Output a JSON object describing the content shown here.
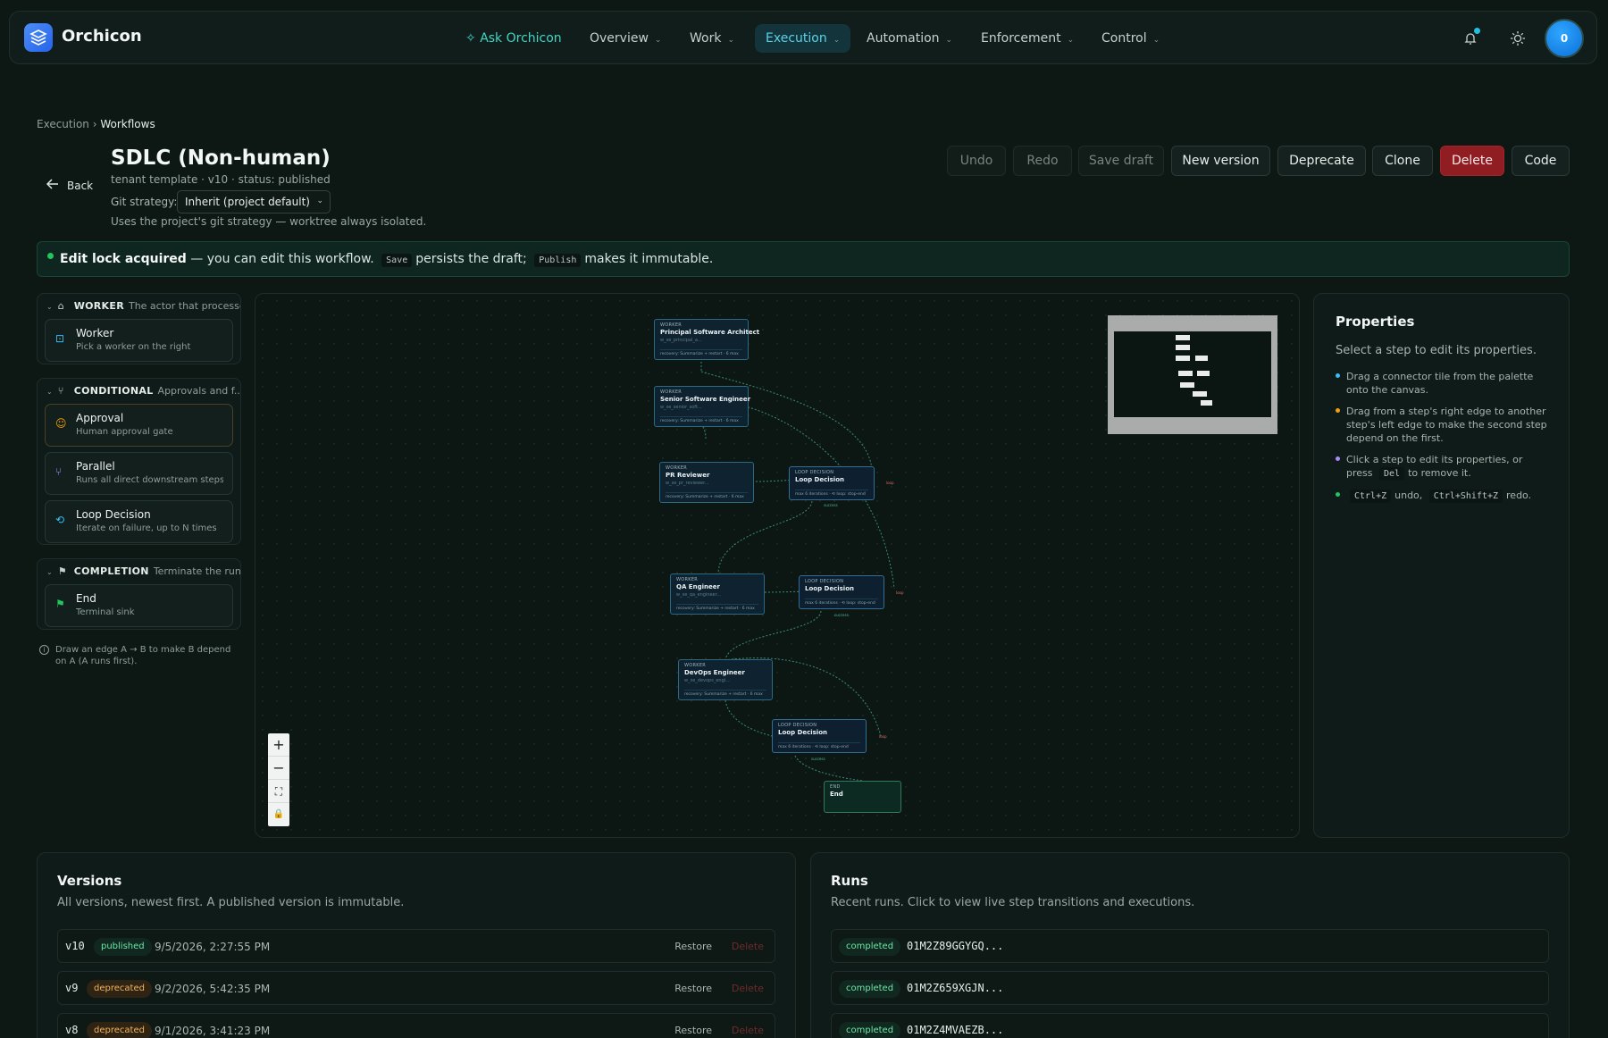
{
  "nav": {
    "brand": "Orchicon",
    "ask": "Ask Orchicon",
    "items": [
      "Overview",
      "Work",
      "Execution",
      "Automation",
      "Enforcement",
      "Control"
    ],
    "avatar": "0",
    "colors": {
      "accent": "#5ad1e8",
      "ask": "#3fd6c6",
      "danger": "#8f1d22",
      "success": "#22c55e"
    }
  },
  "breadcrumb": {
    "parent": "Execution",
    "sep": "›",
    "current": "Workflows"
  },
  "header": {
    "back": "Back",
    "title": "SDLC (Non-human)",
    "subtitle": "tenant template · v10 · status: published",
    "git_label": "Git strategy:",
    "git_value": "Inherit (project default)",
    "git_note": "Uses the project's git strategy — worktree always isolated."
  },
  "toolbar": {
    "undo": "Undo",
    "redo": "Redo",
    "save_draft": "Save draft",
    "new_version": "New version",
    "deprecate": "Deprecate",
    "clone": "Clone",
    "delete": "Delete",
    "code": "Code"
  },
  "banner": {
    "bold": "Edit lock acquired",
    "text1": "— you can edit this workflow.",
    "save": "Save",
    "text2": "persists the draft;",
    "publish": "Publish",
    "text3": "makes it immutable."
  },
  "palette": {
    "worker": {
      "name": "WORKER",
      "desc": "The actor that processe...",
      "tiles": [
        {
          "name": "Worker",
          "desc": "Pick a worker on the right"
        }
      ]
    },
    "conditional": {
      "name": "CONDITIONAL",
      "desc": "Approvals and f...",
      "tiles": [
        {
          "name": "Approval",
          "desc": "Human approval gate"
        },
        {
          "name": "Parallel",
          "desc": "Runs all direct downstream steps co..."
        },
        {
          "name": "Loop Decision",
          "desc": "Iterate on failure, up to N times"
        }
      ]
    },
    "completion": {
      "name": "COMPLETION",
      "desc": "Terminate the run",
      "tiles": [
        {
          "name": "End",
          "desc": "Terminal sink"
        }
      ]
    },
    "hint_a": "Draw an edge A",
    "hint_arrow": "→",
    "hint_b": "B to make B depend on A (A runs first)."
  },
  "canvas": {
    "nodes": [
      {
        "kind": "WORKER",
        "title": "Principal Software Architect",
        "sub": "w_se_principal_a...",
        "foot": "recovery: Summarize + restart · 6 max"
      },
      {
        "kind": "WORKER",
        "title": "Senior Software Engineer",
        "sub": "w_se_senior_soft...",
        "foot": "recovery: Summarize + restart · 6 max"
      },
      {
        "kind": "WORKER",
        "title": "PR Reviewer",
        "sub": "w_se_pr_reviewer...",
        "foot": "recovery: Summarize + restart · 6 max"
      },
      {
        "kind": "LOOP DECISION",
        "title": "Loop Decision",
        "sub": "",
        "foot": "max 6 iterations · ⟲ loop: stop-end"
      },
      {
        "kind": "WORKER",
        "title": "QA Engineer",
        "sub": "w_se_qa_engineer...",
        "foot": "recovery: Summarize + restart · 6 max"
      },
      {
        "kind": "LOOP DECISION",
        "title": "Loop Decision",
        "sub": "",
        "foot": "max 6 iterations · ⟲ loop: stop-end"
      },
      {
        "kind": "WORKER",
        "title": "DevOps Engineer",
        "sub": "w_se_devops_engi...",
        "foot": "recovery: Summarize + restart · 6 max"
      },
      {
        "kind": "LOOP DECISION",
        "title": "Loop Decision",
        "sub": "",
        "foot": "max 6 iterations · ⟲ loop: stop-end"
      },
      {
        "kind": "END",
        "title": "End",
        "sub": "",
        "foot": ""
      }
    ],
    "edge_labels": {
      "loop": "loop",
      "success": "success"
    },
    "zoom": [
      "+",
      "−",
      "⛶",
      "🔒"
    ]
  },
  "properties": {
    "title": "Properties",
    "hint": "Select a step to edit its properties.",
    "tips": [
      {
        "text": "Drag a connector tile from the palette onto the canvas.",
        "color": "#38bdf8"
      },
      {
        "text": "Drag from a step's right edge to another step's left edge to make the second step depend on the first.",
        "color": "#f59e0b"
      },
      {
        "text_a": "Click a step to edit its properties, or press",
        "key": "Del",
        "text_b": "to remove it.",
        "color": "#a78bfa"
      },
      {
        "key1": "Ctrl+Z",
        "mid": "undo,",
        "key2": "Ctrl+Shift+Z",
        "end": "redo.",
        "color": "#22c55e"
      }
    ]
  },
  "versions": {
    "title": "Versions",
    "desc": "All versions, newest first. A published version is immutable.",
    "restore": "Restore",
    "delete": "Delete",
    "rows": [
      {
        "v": "v10",
        "status": "published",
        "date": "9/5/2026, 2:27:55 PM"
      },
      {
        "v": "v9",
        "status": "deprecated",
        "date": "9/2/2026, 5:42:35 PM"
      },
      {
        "v": "v8",
        "status": "deprecated",
        "date": "9/1/2026, 3:41:23 PM"
      }
    ]
  },
  "runs": {
    "title": "Runs",
    "desc": "Recent runs. Click to view live step transitions and executions.",
    "rows": [
      {
        "status": "completed",
        "id": "01M2Z89GGYGQ..."
      },
      {
        "status": "completed",
        "id": "01M2Z659XGJN..."
      },
      {
        "status": "completed",
        "id": "01M2Z4MVAEZB..."
      }
    ]
  }
}
